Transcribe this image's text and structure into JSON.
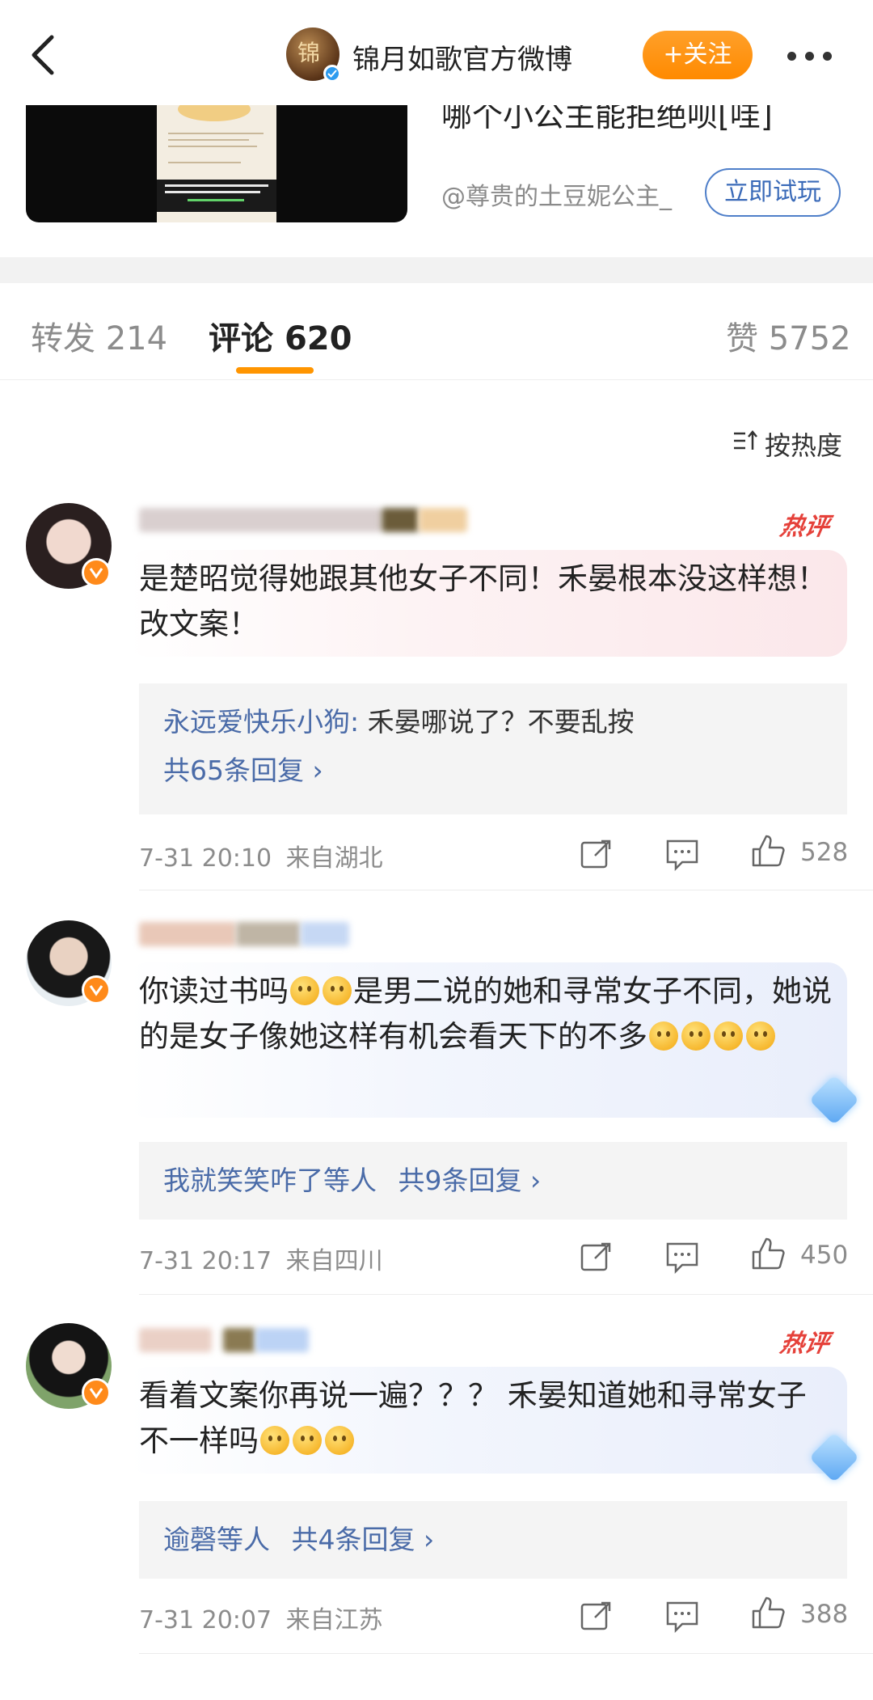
{
  "header": {
    "account_name": "锦月如歌官方微博",
    "account_avatar_glyph": "锦",
    "follow_label": "+关注"
  },
  "shared_card": {
    "title": "哪个小公主能拒绝呗[哇]",
    "user": "@尊贵的土豆妮公主_",
    "action_label": "立即试玩"
  },
  "tabs": [
    {
      "label": "转发",
      "count": "214"
    },
    {
      "label": "评论",
      "count": "620"
    },
    {
      "label": "赞",
      "count": "5752"
    }
  ],
  "sort_label": "按热度",
  "colors": {
    "accent": "#ff8a00",
    "link": "#4a6ba8",
    "hot": "#e5413a"
  },
  "comments": [
    {
      "hot_label": "热评",
      "text": "是楚昭觉得她跟其他女子不同！禾晏根本没这样想！改文案！",
      "reply_preview_user": "永远爱快乐小狗:",
      "reply_preview_text": " 禾晏哪说了？不要乱按",
      "reply_count": "共65条回复 ›",
      "time": "7-31 20:10",
      "location": "来自湖北",
      "likes": "528"
    },
    {
      "text_part1": "你读过书吗",
      "text_part2": "是男二说的她和寻常女子不同，她说的是女子像她这样有机会看天下的不多",
      "reply_preview_user": "我就笑笑咋了等人",
      "reply_count": "共9条回复 ›",
      "time": "7-31 20:17",
      "location": "来自四川",
      "likes": "450"
    },
    {
      "hot_label": "热评",
      "text": "看着文案你再说一遍？？？ 禾晏知道她和寻常女子不一样吗",
      "reply_preview_user": "逾磬等人",
      "reply_count": "共4条回复 ›",
      "time": "7-31 20:07",
      "location": "来自江苏",
      "likes": "388"
    }
  ]
}
